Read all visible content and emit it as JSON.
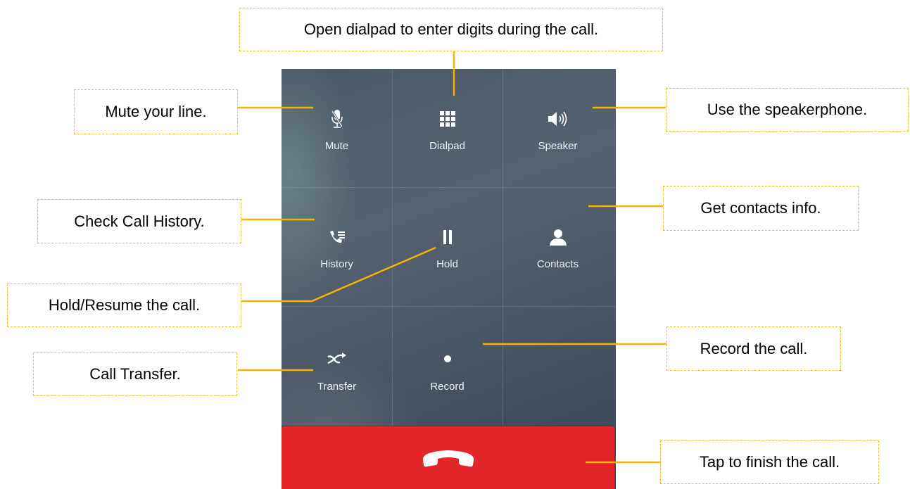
{
  "call_controls": [
    {
      "label": "Mute",
      "icon": "microphone-icon"
    },
    {
      "label": "Dialpad",
      "icon": "dialpad-grid-icon"
    },
    {
      "label": "Speaker",
      "icon": "speaker-icon"
    },
    {
      "label": "History",
      "icon": "call-history-icon"
    },
    {
      "label": "Hold",
      "icon": "pause-icon"
    },
    {
      "label": "Contacts",
      "icon": "person-icon"
    },
    {
      "label": "Transfer",
      "icon": "transfer-arrow-icon"
    },
    {
      "label": "Record",
      "icon": "record-dot-icon"
    }
  ],
  "end_call": {
    "icon": "hang-up-handset-icon",
    "color": "#e3262a"
  },
  "annotations": {
    "dialpad": "Open dialpad to enter digits during the call.",
    "mute": "Mute your line.",
    "speaker": "Use the speakerphone.",
    "history": "Check Call History.",
    "contacts": "Get contacts info.",
    "hold": "Hold/Resume the call.",
    "transfer": "Call Transfer.",
    "record": "Record the call.",
    "end_call": "Tap to finish the call."
  },
  "colors": {
    "callout_border": "#f4bd1c",
    "leader_line": "#f4b400",
    "panel_background": "#4b5866"
  }
}
